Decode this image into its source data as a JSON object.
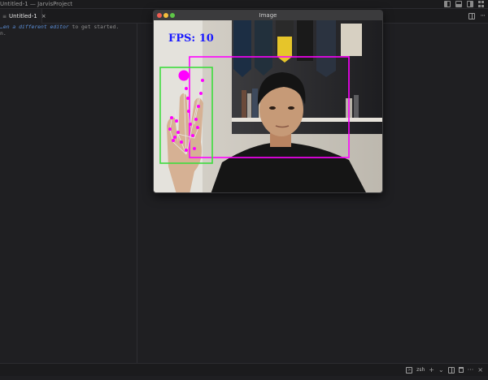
{
  "window_title": "Untitled-1 — JarvisProject",
  "tab": {
    "label": "Untitled-1",
    "file_icon": "≡",
    "close_glyph": "×"
  },
  "editor": {
    "hint_link": "…en a different editor",
    "hint_suffix": " to get started.",
    "line2": "n."
  },
  "image_window": {
    "title": "Image",
    "fps_text": "FPS: 10"
  },
  "terminal": {
    "label": "zsh",
    "add_glyph": "+",
    "dropdown_glyph": "⌄",
    "more_glyph": "···",
    "close_glyph": "×",
    "terminal_glyph": ">"
  },
  "colors": {
    "editor_bg": "#1f1f22",
    "link": "#5b8fd9",
    "landmark": "#ff00ff",
    "hand_box": "#3ddc3d",
    "fps": "#1a1aff"
  }
}
